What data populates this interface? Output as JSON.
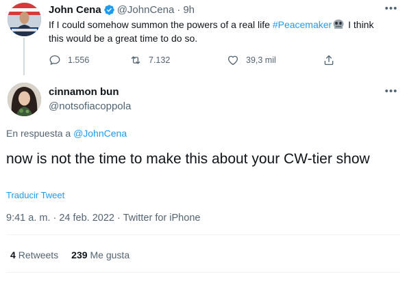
{
  "parent_tweet": {
    "author_name": "John Cena",
    "author_handle": "@JohnCena",
    "separator": "·",
    "time": "9h",
    "text_before": "If I could somehow summon the powers of a real life",
    "hashtag": "#Peacemaker",
    "text_after": "I think this would be a great time to do so.",
    "emoji": "alien-monster-emoji",
    "replies": "1.556",
    "retweets": "7.132",
    "likes": "39,3 mil",
    "icons": {
      "reply": "reply-icon",
      "retweet": "retweet-icon",
      "like": "heart-icon",
      "share": "share-icon",
      "verified": "verified-badge-icon",
      "more": "more-options-icon"
    }
  },
  "main_tweet": {
    "author_name": "cinnamon bun",
    "author_handle": "@notsofiacoppola",
    "reply_prefix": "En respuesta a",
    "reply_mention": "@JohnCena",
    "text": "now is not the time to make this about your CW-tier show",
    "translate_label": "Traducir Tweet",
    "meta": "9:41 a. m. · 24 feb. 2022 · Twitter for iPhone",
    "retweets_count": "4",
    "retweets_label": "Retweets",
    "likes_count": "239",
    "likes_label": "Me gusta"
  },
  "colors": {
    "accent": "#1d9bf0",
    "text_primary": "#0f1419",
    "text_secondary": "#536471",
    "divider": "#eff3f4"
  }
}
